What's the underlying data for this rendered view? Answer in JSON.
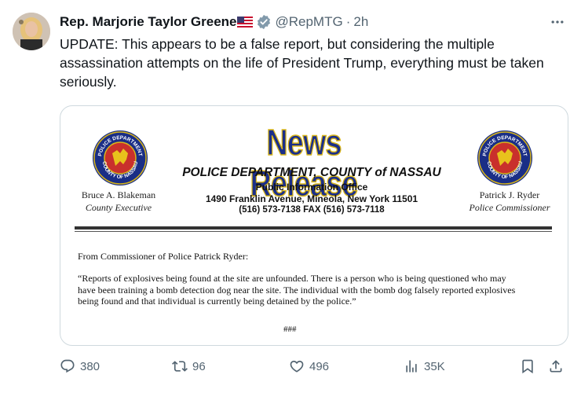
{
  "author": {
    "name": "Rep. Marjorie Taylor Greene",
    "handle": "@RepMTG",
    "separator": "·",
    "time": "2h"
  },
  "tweet_text": "UPDATE: This appears to be a false report, but considering the multiple assassination attempts on the life of President Trump, everything must be taken seriously.",
  "media": {
    "title": "News Release",
    "department": "POLICE DEPARTMENT, COUNTY of NASSAU",
    "office": "Public Information Office",
    "address": "1490 Franklin Avenue, Mineola, New York 11501",
    "phone": "(516) 573-7138 FAX (516) 573-7118",
    "left_official_name": "Bruce A. Blakeman",
    "left_official_title": "County Executive",
    "right_official_name": "Patrick J. Ryder",
    "right_official_title": "Police Commissioner",
    "seal_text_top": "POLICE DEPARTMENT",
    "seal_text_bottom": "COUNTY OF NASSAU",
    "from_line": "From Commissioner of Police Patrick Ryder:",
    "body": "“Reports of explosives being found at the site are unfounded. There is a person who is being questioned who may have been training a bomb detection dog near the site. The individual with the bomb dog falsely reported explosives being found and that individual is currently being detained by the police.”",
    "end_mark": "###"
  },
  "actions": {
    "replies": "380",
    "reposts": "96",
    "likes": "496",
    "views": "35K"
  },
  "colors": {
    "text": "#0f1419",
    "secondary": "#536471",
    "verified": "#829aab",
    "border": "#cfd9de",
    "news_blue": "#1b2f8a",
    "news_gold": "#d9b61a"
  }
}
